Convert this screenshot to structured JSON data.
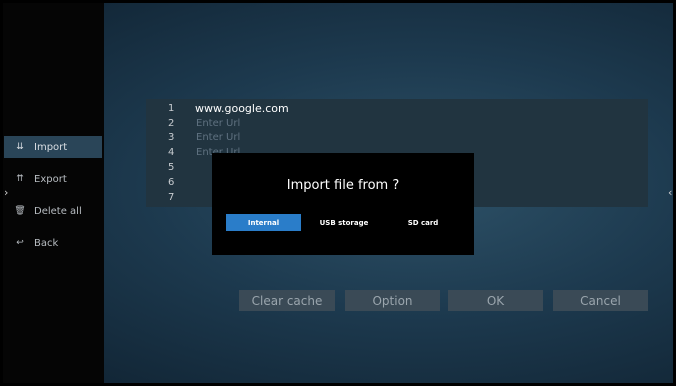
{
  "sidebar": {
    "items": [
      {
        "label": "Import",
        "icon": "import-icon",
        "glyph": "⇊"
      },
      {
        "label": "Export",
        "icon": "export-icon",
        "glyph": "⇈"
      },
      {
        "label": "Delete all",
        "icon": "trash-icon",
        "glyph": "🗑"
      },
      {
        "label": "Back",
        "icon": "back-icon",
        "glyph": "↩"
      }
    ],
    "active_index": 0
  },
  "nav": {
    "left_arrow": "›",
    "right_arrow": "‹"
  },
  "url_list": [
    {
      "num": "1",
      "text": "www.google.com"
    },
    {
      "num": "2",
      "text": "Enter Url"
    },
    {
      "num": "3",
      "text": "Enter Url"
    },
    {
      "num": "4",
      "text": "Enter Url"
    },
    {
      "num": "5",
      "text": ""
    },
    {
      "num": "6",
      "text": ""
    },
    {
      "num": "7",
      "text": ""
    }
  ],
  "dialog": {
    "title": "Import file from ?",
    "options": [
      {
        "label": "Internal",
        "selected": true
      },
      {
        "label": "USB storage",
        "selected": false
      },
      {
        "label": "SD card",
        "selected": false
      }
    ]
  },
  "buttons": {
    "clear_cache": "Clear cache",
    "option": "Option",
    "ok": "OK",
    "cancel": "Cancel"
  },
  "colors": {
    "selected_option": "#2a7dc9",
    "active_sidebar": "#2a4558"
  }
}
